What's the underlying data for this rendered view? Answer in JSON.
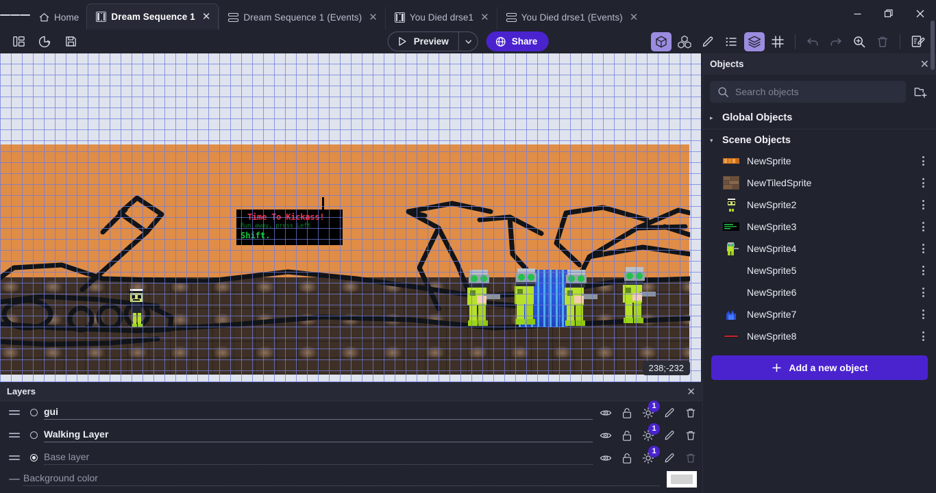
{
  "window": {
    "minimize_label": "—",
    "maximize_label": "▢",
    "close_label": "✕"
  },
  "menu": {
    "hamburger_label": "menu-icon"
  },
  "tabs": [
    {
      "label": "Home",
      "icon": "home-icon",
      "active": false,
      "closable": false
    },
    {
      "label": "Dream Sequence 1",
      "icon": "scene-icon",
      "active": true,
      "closable": true,
      "close_label": "✕"
    },
    {
      "label": "Dream Sequence 1 (Events)",
      "icon": "events-icon",
      "active": false,
      "closable": true,
      "close_label": "✕"
    },
    {
      "label": "You Died drse1",
      "icon": "scene-icon",
      "active": false,
      "closable": true,
      "close_label": "✕"
    },
    {
      "label": "You Died drse1 (Events)",
      "icon": "events-icon",
      "active": false,
      "closable": true,
      "close_label": "✕"
    }
  ],
  "toolbar": {
    "left_icons": [
      "panels-icon",
      "history-icon",
      "save-icon"
    ],
    "preview_label": "Preview",
    "preview_caret_label": "chevron-down-icon",
    "share_label": "Share",
    "right_icons": [
      {
        "name": "objects-icon",
        "selected": true,
        "dim": false
      },
      {
        "name": "object-groups-icon",
        "selected": false,
        "dim": false
      },
      {
        "name": "properties-icon",
        "selected": false,
        "dim": false
      },
      {
        "name": "instances-list-icon",
        "selected": false,
        "dim": false
      },
      {
        "name": "layers-icon",
        "selected": true,
        "dim": false
      },
      {
        "name": "grid-icon",
        "selected": false,
        "dim": false
      },
      {
        "name": "undo-icon",
        "selected": false,
        "dim": true
      },
      {
        "name": "redo-icon",
        "selected": false,
        "dim": true
      },
      {
        "name": "zoom-icon",
        "selected": false,
        "dim": false
      },
      {
        "name": "trash-icon",
        "selected": false,
        "dim": true
      },
      {
        "name": "open-editor-icon",
        "selected": false,
        "dim": false
      }
    ],
    "accent_color": "#4a23cf",
    "selected_icon_color": "#9b8ce0"
  },
  "canvas": {
    "coordinates": "238;-232",
    "sign": {
      "line1": "Time To Kickass!",
      "line2": "Run away, press Left",
      "line3": "Shift.",
      "line1_color": "#ff2f4a",
      "line3_color": "#14c93e"
    },
    "sky_color": "#dfe3ee",
    "ground_color": "#e08d48",
    "grid_color": "#6e7cdc"
  },
  "layers_panel": {
    "title": "Layers",
    "close_label": "✕",
    "background_color_label": "Background color",
    "rows": [
      {
        "name": "gui",
        "selected": false,
        "dim": false,
        "lighting_badge": "1",
        "delete_enabled": true
      },
      {
        "name": "Walking Layer",
        "selected": false,
        "dim": false,
        "lighting_badge": "1",
        "delete_enabled": true
      },
      {
        "name": "Base layer",
        "selected": true,
        "dim": true,
        "lighting_badge": "1",
        "delete_enabled": false
      }
    ],
    "action_icons": [
      "eye-icon",
      "unlock-icon",
      "lighting-icon",
      "edit-icon",
      "delete-icon"
    ],
    "background_swatch_color": "#d3d3d3"
  },
  "objects_panel": {
    "title": "Objects",
    "close_label": "✕",
    "search_placeholder": "Search objects",
    "search_value": "",
    "new_folder_label": "new-folder-icon",
    "groups": [
      {
        "label": "Global Objects",
        "expanded": false,
        "caret": "▸"
      },
      {
        "label": "Scene Objects",
        "expanded": true,
        "caret": "▾"
      }
    ],
    "items": [
      {
        "name": "NewSprite",
        "thumb": "orange-bar",
        "menu": "kebab-icon"
      },
      {
        "name": "NewTiledSprite",
        "thumb": "brick",
        "menu": "kebab-icon"
      },
      {
        "name": "NewSprite2",
        "thumb": "character",
        "menu": "kebab-icon"
      },
      {
        "name": "NewSprite3",
        "thumb": "green-text",
        "menu": "kebab-icon"
      },
      {
        "name": "NewSprite4",
        "thumb": "soldier",
        "menu": "kebab-icon"
      },
      {
        "name": "NewSprite5",
        "thumb": "none",
        "menu": "kebab-icon"
      },
      {
        "name": "NewSprite6",
        "thumb": "none",
        "menu": "kebab-icon"
      },
      {
        "name": "NewSprite7",
        "thumb": "blue-blob",
        "menu": "kebab-icon"
      },
      {
        "name": "NewSprite8",
        "thumb": "red-bar",
        "menu": "kebab-icon"
      }
    ],
    "add_button_label": "Add a new object",
    "add_button_icon": "plus-icon"
  }
}
